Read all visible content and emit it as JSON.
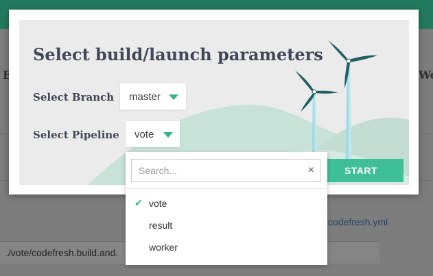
{
  "background": {
    "left_letter": "E",
    "right_text": "Wel",
    "yaml_link": "codefresh.yml",
    "path_value": "./vote/codefresh.build.and."
  },
  "modal": {
    "title": "Select build/launch parameters",
    "branch": {
      "label": "Select Branch",
      "value": "master"
    },
    "pipeline": {
      "label": "Select Pipeline",
      "value": "vote"
    },
    "start_label": "START"
  },
  "dropdown": {
    "search_placeholder": "Search...",
    "clear_icon": "×",
    "check_icon": "✔",
    "options": [
      {
        "label": "vote",
        "selected": true
      },
      {
        "label": "result",
        "selected": false
      },
      {
        "label": "worker",
        "selected": false
      }
    ]
  },
  "colors": {
    "accent": "#2fb58b",
    "button": "#3fbf97",
    "topbar": "#217a5f",
    "hero_bg": "#ebebeb",
    "title_text": "#404757"
  }
}
